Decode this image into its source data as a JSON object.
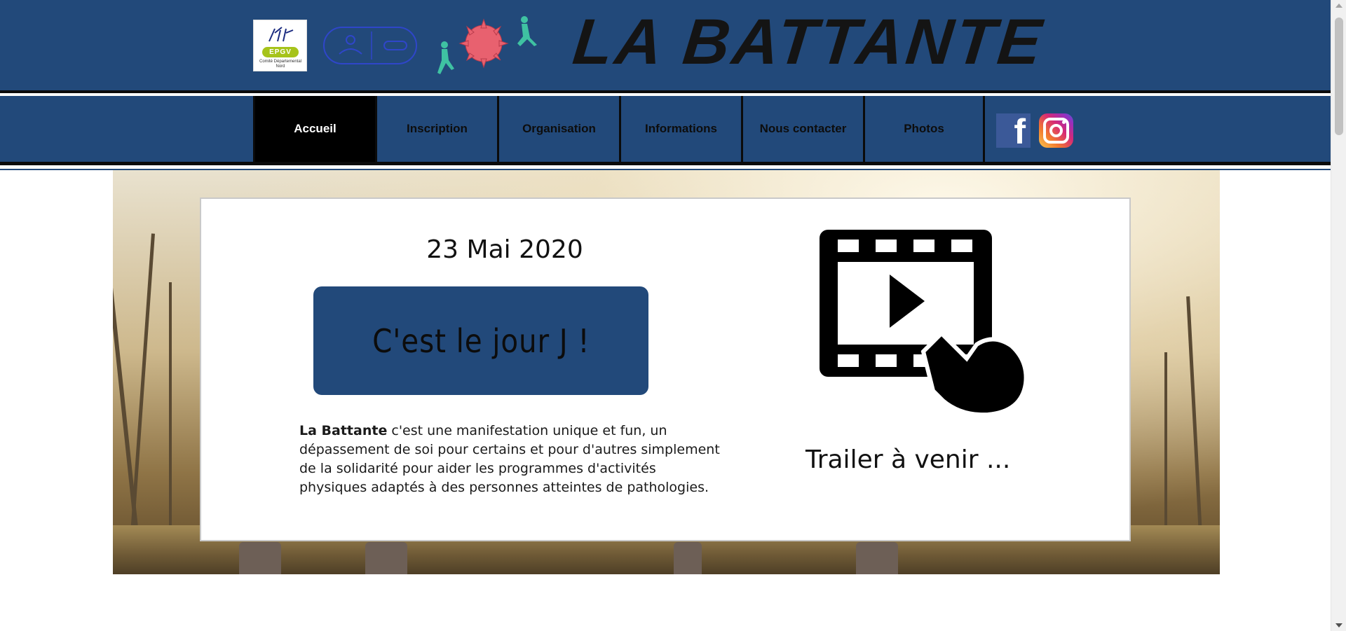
{
  "header": {
    "title": "LA BATTANTE",
    "logos": [
      {
        "name": "epgv-logo",
        "text": "EPGV",
        "subtext": "Comité Départemental Nord"
      },
      {
        "name": "sport-sante-logo"
      },
      {
        "name": "virus-runners-logo"
      }
    ],
    "colors": {
      "background": "#22497a",
      "accent_green": "#a6c31a"
    }
  },
  "nav": {
    "items": [
      {
        "label": "Accueil",
        "active": true
      },
      {
        "label": "Inscription",
        "active": false
      },
      {
        "label": "Organisation",
        "active": false
      },
      {
        "label": "Informations",
        "active": false
      },
      {
        "label": "Nous contacter",
        "active": false
      },
      {
        "label": "Photos",
        "active": false
      }
    ],
    "social": [
      "facebook-icon",
      "instagram-icon"
    ]
  },
  "main": {
    "date": "23 Mai 2020",
    "cta_label": "C'est le jour J !",
    "description_bold": "La Battante",
    "description_rest": " c'est une manifestation unique et fun, un dépassement de soi pour certains et pour d'autres simplement de la solidarité pour aider les programmes d'activités physiques adaptés à des personnes atteintes de pathologies.",
    "video_icon": "video-play-hand-icon",
    "trailer_text": "Trailer à venir ..."
  }
}
